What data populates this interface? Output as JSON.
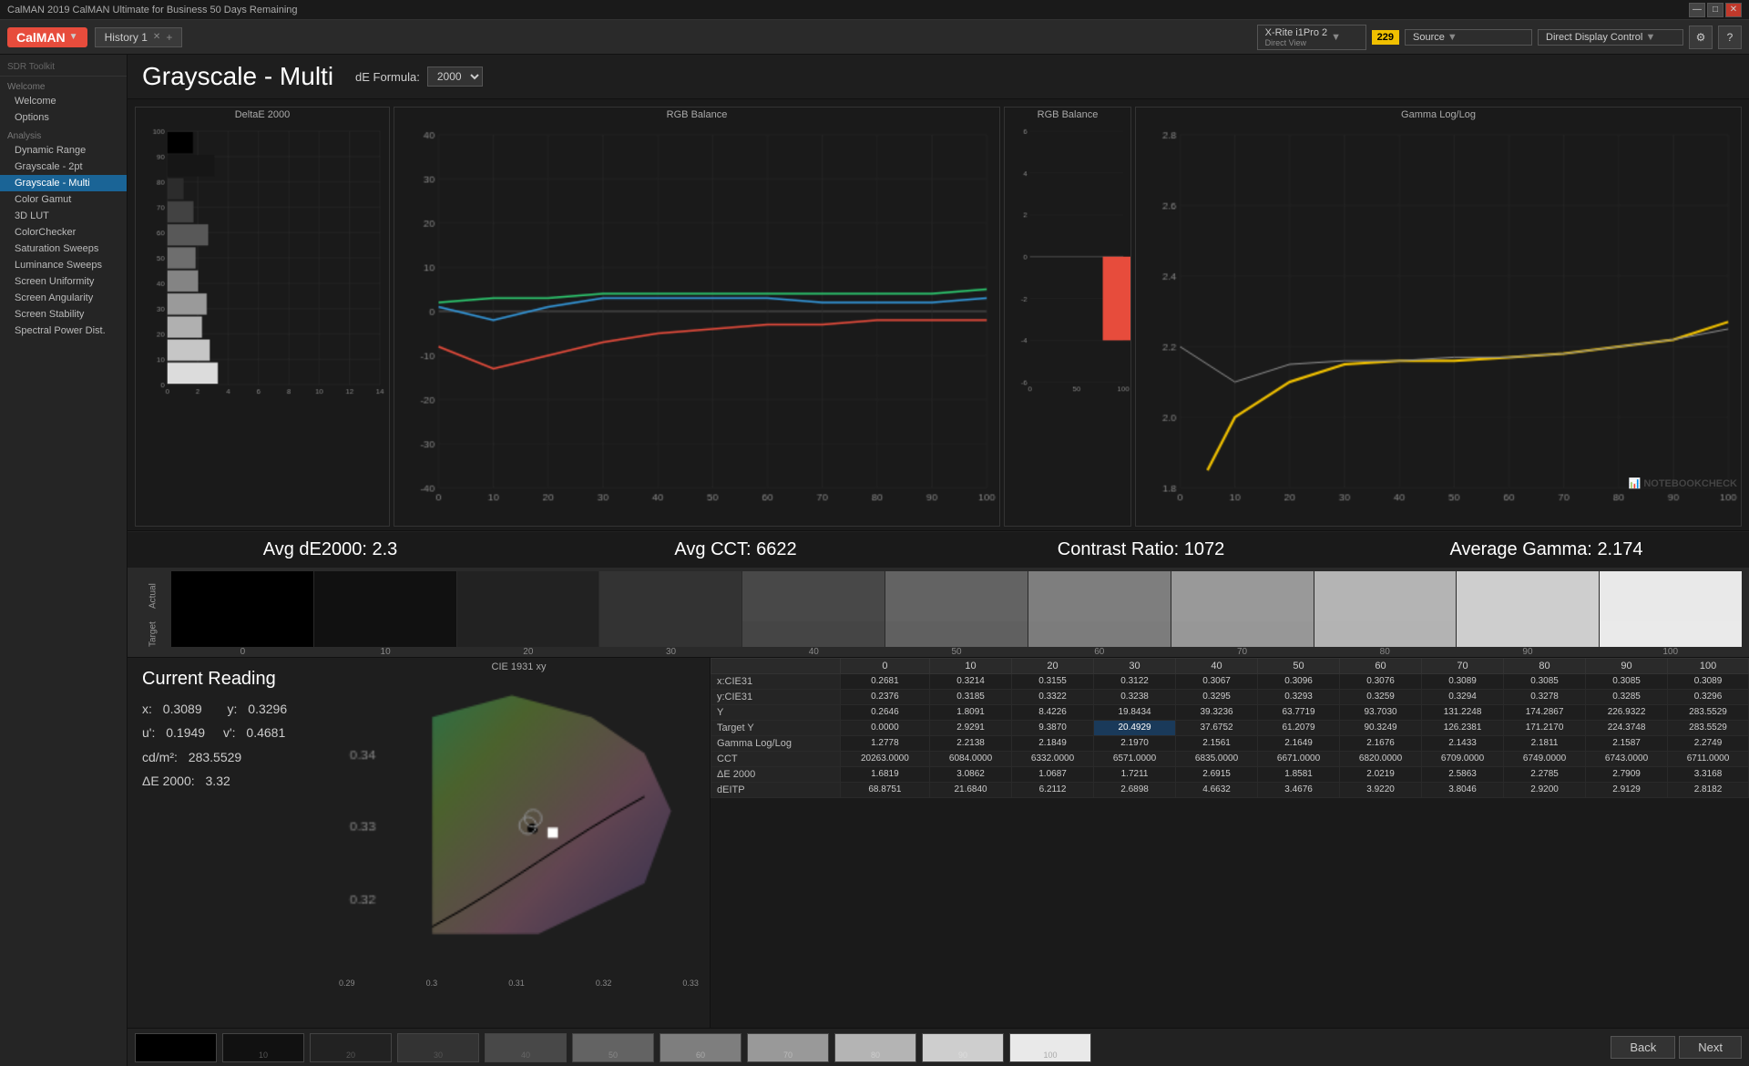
{
  "titlebar": {
    "title": "CalMAN 2019 CalMAN Ultimate for Business 50 Days Remaining",
    "controls": [
      "—",
      "□",
      "✕"
    ]
  },
  "toolbar": {
    "logo": "CalMAN",
    "history_tab": "History 1",
    "device_name": "X-Rite i1Pro 2",
    "device_mode": "Direct View",
    "badge": "229",
    "source_label": "Source",
    "source_value": "",
    "ddc_label": "Direct Display Control",
    "gear_icon": "⚙",
    "settings_icon": "⚙"
  },
  "sidebar": {
    "toolkit_label": "SDR Toolkit",
    "sections": [
      {
        "label": "Welcome",
        "type": "section"
      },
      {
        "label": "Welcome",
        "type": "item",
        "indent": true
      },
      {
        "label": "Options",
        "type": "item",
        "indent": true
      },
      {
        "label": "Analysis",
        "type": "section"
      },
      {
        "label": "Dynamic Range",
        "type": "item",
        "indent": true
      },
      {
        "label": "Grayscale - 2pt",
        "type": "item",
        "indent": true
      },
      {
        "label": "Grayscale - Multi",
        "type": "item",
        "indent": true,
        "active": true
      },
      {
        "label": "Color Gamut",
        "type": "item",
        "indent": true
      },
      {
        "label": "3D LUT",
        "type": "item",
        "indent": true
      },
      {
        "label": "ColorChecker",
        "type": "item",
        "indent": true
      },
      {
        "label": "Saturation Sweeps",
        "type": "item",
        "indent": true
      },
      {
        "label": "Luminance Sweeps",
        "type": "item",
        "indent": true
      },
      {
        "label": "Screen Uniformity",
        "type": "item",
        "indent": true
      },
      {
        "label": "Screen Angularity",
        "type": "item",
        "indent": true
      },
      {
        "label": "Screen Stability",
        "type": "item",
        "indent": true
      },
      {
        "label": "Spectral Power Dist.",
        "type": "item",
        "indent": true
      }
    ]
  },
  "page": {
    "title": "Grayscale - Multi",
    "de_formula_label": "dE Formula:",
    "de_formula_value": "2000"
  },
  "deltae_chart": {
    "title": "DeltaE 2000",
    "y_labels": [
      "100",
      "90",
      "80",
      "70",
      "60",
      "50",
      "40",
      "30",
      "20",
      "10",
      "0"
    ],
    "x_labels": [
      "0",
      "2",
      "4",
      "6",
      "8",
      "10",
      "12",
      "14"
    ]
  },
  "rgb_balance_chart1": {
    "title": "RGB Balance",
    "y_max": 40,
    "y_min": -40
  },
  "rgb_balance_chart2": {
    "title": "RGB Balance",
    "y_max": 6,
    "y_min": -6
  },
  "gamma_chart": {
    "title": "Gamma Log/Log",
    "y_max": 2.8,
    "y_min": 1.8
  },
  "stats": {
    "avg_de_label": "Avg dE2000:",
    "avg_de_value": "2.3",
    "avg_cct_label": "Avg CCT:",
    "avg_cct_value": "6622",
    "contrast_label": "Contrast Ratio:",
    "contrast_value": "1072",
    "avg_gamma_label": "Average Gamma:",
    "avg_gamma_value": "2.174"
  },
  "swatches": {
    "labels_top": [
      "Actual"
    ],
    "labels_bottom": [
      "Target"
    ],
    "x_labels": [
      "0",
      "10",
      "20",
      "30",
      "40",
      "50",
      "60",
      "70",
      "80",
      "90",
      "100"
    ],
    "grays": [
      0,
      10,
      20,
      30,
      40,
      50,
      60,
      70,
      80,
      90,
      100
    ]
  },
  "current_reading": {
    "title": "Current Reading",
    "x_label": "x:",
    "x_val": "0.3089",
    "y_label": "y:",
    "y_val": "0.3296",
    "up_label": "u':",
    "up_val": "0.1949",
    "vp_label": "v':",
    "vp_val": "0.4681",
    "cd_label": "cd/m²:",
    "cd_val": "283.5529",
    "de_label": "ΔE 2000:",
    "de_val": "3.32"
  },
  "cie_chart": {
    "title": "CIE 1931 xy",
    "x_labels": [
      "0.29",
      "0.3",
      "0.31",
      "0.32",
      "0.33"
    ],
    "y_labels": [
      "0.32",
      "0.33",
      "0.34"
    ]
  },
  "table": {
    "headers": [
      "",
      "0",
      "10",
      "20",
      "30",
      "40",
      "50",
      "60",
      "70",
      "80",
      "90",
      "100"
    ],
    "rows": [
      {
        "label": "x:CIE31",
        "values": [
          "0.2681",
          "0.3214",
          "0.3155",
          "0.3122",
          "0.3067",
          "0.3096",
          "0.3076",
          "0.3089",
          "0.3085",
          "0.3085",
          "0.3089"
        ]
      },
      {
        "label": "y:CIE31",
        "values": [
          "0.2376",
          "0.3185",
          "0.3322",
          "0.3238",
          "0.3295",
          "0.3293",
          "0.3259",
          "0.3294",
          "0.3278",
          "0.3285",
          "0.3296"
        ]
      },
      {
        "label": "Y",
        "values": [
          "0.2646",
          "1.8091",
          "8.4226",
          "19.8434",
          "39.3236",
          "63.7719",
          "93.7030",
          "131.2248",
          "174.2867",
          "226.9322",
          "283.5529"
        ]
      },
      {
        "label": "Target Y",
        "values": [
          "0.0000",
          "2.9291",
          "9.3870",
          "20.4929",
          "37.6752",
          "61.2079",
          "90.3249",
          "126.2381",
          "171.2170",
          "224.3748",
          "283.5529"
        ],
        "highlight": [
          3
        ]
      },
      {
        "label": "Gamma Log/Log",
        "values": [
          "1.2778",
          "2.2138",
          "2.1849",
          "2.1970",
          "2.1561",
          "2.1649",
          "2.1676",
          "2.1433",
          "2.1811",
          "2.1587",
          "2.2749"
        ]
      },
      {
        "label": "CCT",
        "values": [
          "20263.0000",
          "6084.0000",
          "6332.0000",
          "6571.0000",
          "6835.0000",
          "6671.0000",
          "6820.0000",
          "6709.0000",
          "6749.0000",
          "6743.0000",
          "6711.0000"
        ]
      },
      {
        "label": "ΔE 2000",
        "values": [
          "1.6819",
          "3.0862",
          "1.0687",
          "1.7211",
          "2.6915",
          "1.8581",
          "2.0219",
          "2.5863",
          "2.2785",
          "2.7909",
          "3.3168"
        ]
      },
      {
        "label": "dEITP",
        "values": [
          "68.8751",
          "21.6840",
          "6.2112",
          "2.6898",
          "4.6632",
          "3.4676",
          "3.9220",
          "3.8046",
          "2.9200",
          "2.9129",
          "2.8182"
        ]
      }
    ]
  },
  "bottom_nav": {
    "back_label": "Back",
    "next_label": "Next"
  },
  "watermark": "NOTEBOOKCHECK"
}
